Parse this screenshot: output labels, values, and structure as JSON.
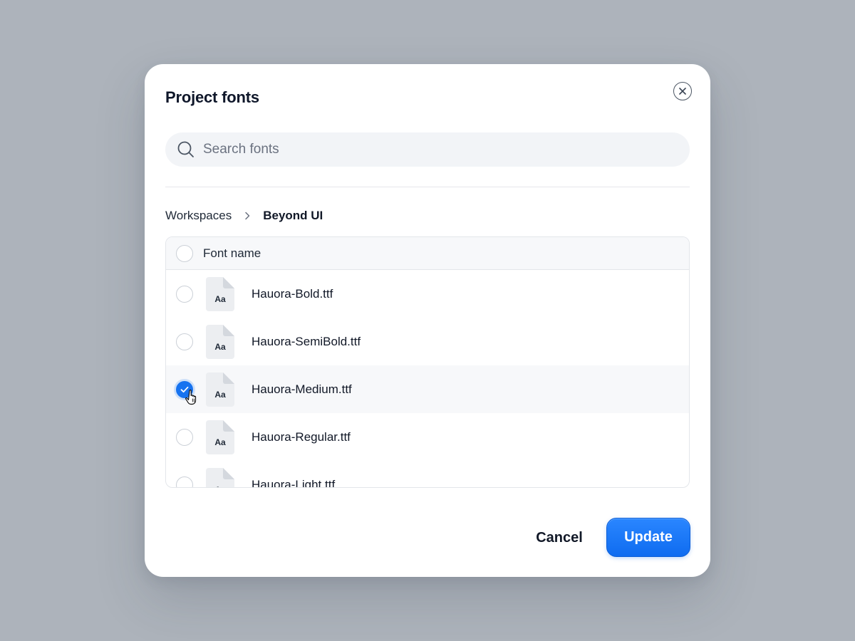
{
  "dialog": {
    "title": "Project fonts"
  },
  "search": {
    "placeholder": "Search fonts",
    "value": ""
  },
  "breadcrumb": {
    "items": [
      "Workspaces",
      "Beyond UI"
    ]
  },
  "table": {
    "header_label": "Font name",
    "file_icon_text": "Aa",
    "rows": [
      {
        "name": "Hauora-Bold.ttf",
        "checked": false
      },
      {
        "name": "Hauora-SemiBold.ttf",
        "checked": false
      },
      {
        "name": "Hauora-Medium.ttf",
        "checked": true
      },
      {
        "name": "Hauora-Regular.ttf",
        "checked": false
      },
      {
        "name": "Hauora-Light.ttf",
        "checked": false
      }
    ]
  },
  "footer": {
    "cancel_label": "Cancel",
    "update_label": "Update"
  },
  "colors": {
    "accent": "#1673f0",
    "backdrop": "#adb3bb"
  },
  "icons": {
    "close": "close-icon",
    "search": "search-icon",
    "breadcrumb_separator": "chevron-right-icon",
    "file": "font-file-icon",
    "check": "check-icon",
    "cursor": "hand-pointer-icon"
  }
}
